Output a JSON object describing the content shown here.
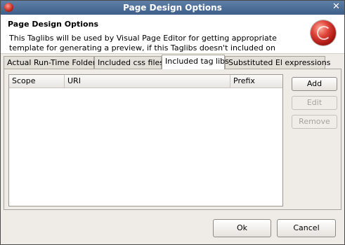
{
  "window": {
    "title": "Page Design Options"
  },
  "banner": {
    "heading": "Page Design Options",
    "description": "This Taglibs will be used by Visual Page Editor for getting appropriate template for generating a preview, if this Taglibs doesn't included on page"
  },
  "tabs": [
    {
      "label": "Actual Run-Time Folders"
    },
    {
      "label": "Included css files"
    },
    {
      "label": "Included tag libs"
    },
    {
      "label": "Substituted El expressions"
    }
  ],
  "table": {
    "columns": [
      "Scope",
      "URI",
      "Prefix"
    ],
    "rows": []
  },
  "side_buttons": {
    "add": "Add",
    "edit": "Edit",
    "remove": "Remove"
  },
  "footer": {
    "ok": "Ok",
    "cancel": "Cancel"
  },
  "colors": {
    "titlebar": "#4e6f98",
    "logo": "#c4261c"
  }
}
